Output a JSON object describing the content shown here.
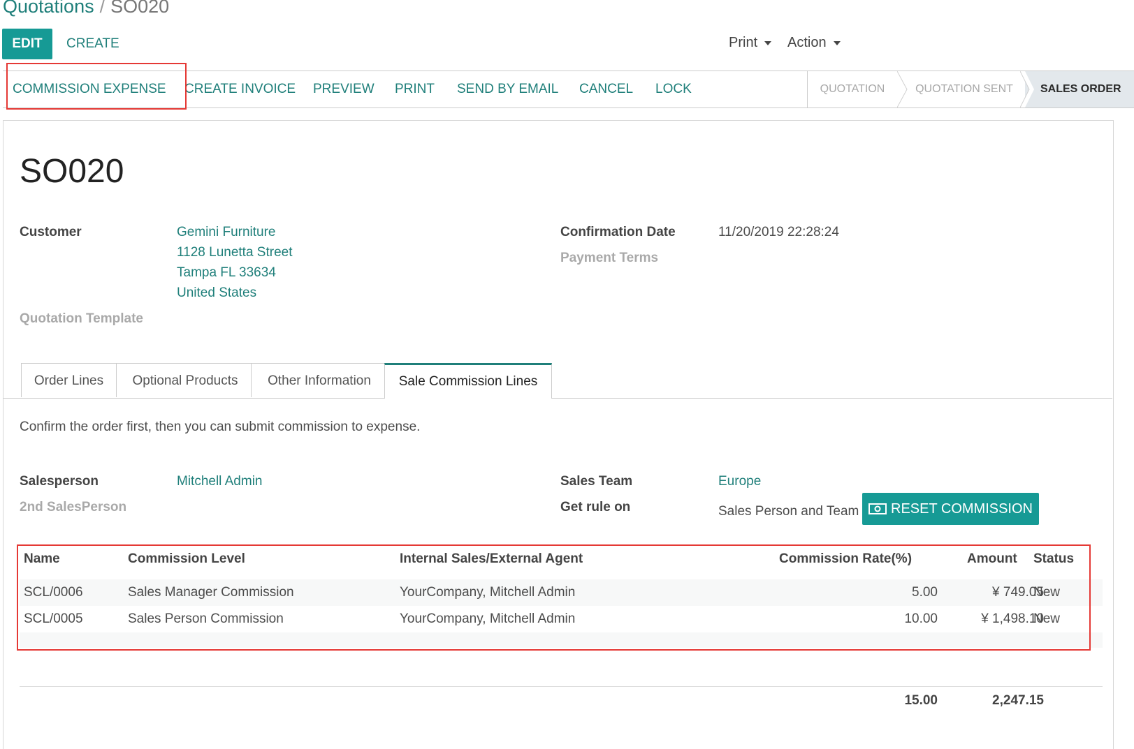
{
  "breadcrumb": {
    "parent": "Quotations",
    "separator": "/",
    "current": "SO020"
  },
  "control": {
    "edit": "EDIT",
    "create": "CREATE",
    "print": "Print",
    "action": "Action"
  },
  "header_buttons": [
    "COMMISSION EXPENSE",
    "CREATE INVOICE",
    "PREVIEW",
    "PRINT",
    "SEND BY EMAIL",
    "CANCEL",
    "LOCK"
  ],
  "stages": [
    {
      "label": "QUOTATION",
      "active": false
    },
    {
      "label": "QUOTATION SENT",
      "active": false
    },
    {
      "label": "SALES ORDER",
      "active": true
    }
  ],
  "record": {
    "name": "SO020"
  },
  "fields": {
    "customer_label": "Customer",
    "customer_lines": [
      "Gemini Furniture",
      "1128 Lunetta Street",
      "Tampa FL 33634",
      "United States"
    ],
    "quotation_template_label": "Quotation Template",
    "confirmation_date_label": "Confirmation Date",
    "confirmation_date_value": "11/20/2019 22:28:24",
    "payment_terms_label": "Payment Terms"
  },
  "tabs": [
    {
      "label": "Order Lines",
      "active": false
    },
    {
      "label": "Optional Products",
      "active": false
    },
    {
      "label": "Other Information",
      "active": false
    },
    {
      "label": "Sale Commission Lines",
      "active": true
    }
  ],
  "commission": {
    "note": "Confirm the order first, then you can submit commission to expense.",
    "salesperson_label": "Salesperson",
    "salesperson_value": "Mitchell Admin",
    "second_salesperson_label": "2nd SalesPerson",
    "sales_team_label": "Sales Team",
    "sales_team_value": "Europe",
    "get_rule_on_label": "Get rule on",
    "get_rule_on_value": "Sales Person and Team",
    "reset_button": "RESET COMMISSION"
  },
  "table": {
    "columns": [
      "Name",
      "Commission Level",
      "Internal Sales/External Agent",
      "Commission Rate(%)",
      "Amount",
      "Status"
    ],
    "rows": [
      {
        "name": "SCL/0006",
        "level": "Sales Manager Commission",
        "agent": "YourCompany, Mitchell Admin",
        "rate": "5.00",
        "amount": "¥ 749.05",
        "status": "New"
      },
      {
        "name": "SCL/0005",
        "level": "Sales Person Commission",
        "agent": "YourCompany, Mitchell Admin",
        "rate": "10.00",
        "amount": "¥ 1,498.10",
        "status": "New"
      }
    ],
    "totals": {
      "rate": "15.00",
      "amount": "2,247.15"
    }
  },
  "colors": {
    "accent": "#169a95",
    "link": "#1f7f7a",
    "highlight": "#e53935",
    "active_stage_bg": "#e3e8ec"
  }
}
